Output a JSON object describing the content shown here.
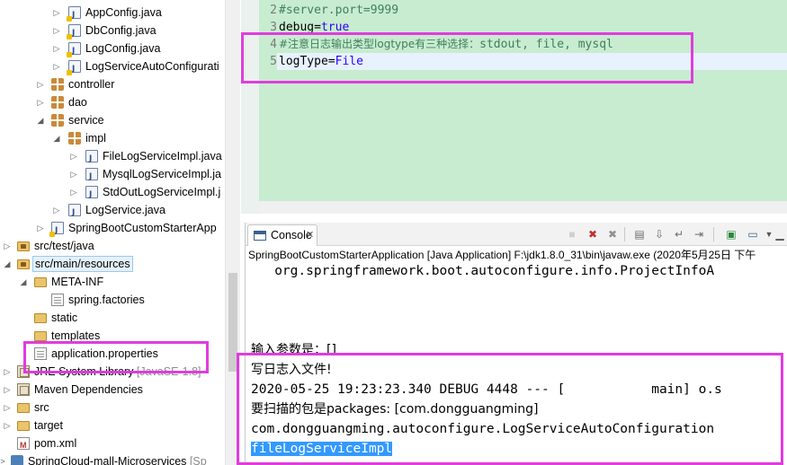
{
  "explorer": {
    "items": [
      {
        "label": "AppConfig.java",
        "icon": "java-file-icon",
        "twisty": "collapsed",
        "warn": true
      },
      {
        "label": "DbConfig.java",
        "icon": "java-file-icon",
        "twisty": "collapsed",
        "warn": true
      },
      {
        "label": "LogConfig.java",
        "icon": "java-file-icon",
        "twisty": "collapsed",
        "warn": true
      },
      {
        "label": "LogServiceAutoConfigurati",
        "icon": "java-file-icon",
        "twisty": "collapsed",
        "warn": true
      },
      {
        "label": "controller",
        "icon": "package-icon",
        "twisty": "collapsed"
      },
      {
        "label": "dao",
        "icon": "package-icon",
        "twisty": "collapsed"
      },
      {
        "label": "service",
        "icon": "package-icon",
        "twisty": "expanded"
      },
      {
        "label": "impl",
        "icon": "package-icon",
        "twisty": "expanded"
      },
      {
        "label": "FileLogServiceImpl.java",
        "icon": "java-file-icon",
        "twisty": "collapsed"
      },
      {
        "label": "MysqlLogServiceImpl.ja",
        "icon": "java-file-icon",
        "twisty": "collapsed"
      },
      {
        "label": "StdOutLogServiceImpl.j",
        "icon": "java-file-icon",
        "twisty": "collapsed"
      },
      {
        "label": "LogService.java",
        "icon": "java-file-icon",
        "twisty": "collapsed"
      },
      {
        "label": "SpringBootCustomStarterApp",
        "icon": "java-file-icon",
        "twisty": "collapsed",
        "warn": true
      },
      {
        "label": "src/test/java",
        "icon": "source-folder-icon",
        "twisty": "collapsed"
      },
      {
        "label": "src/main/resources",
        "icon": "source-folder-icon",
        "twisty": "expanded",
        "selected": true
      },
      {
        "label": "META-INF",
        "icon": "folder-icon",
        "twisty": "expanded"
      },
      {
        "label": "spring.factories",
        "icon": "file-icon"
      },
      {
        "label": "static",
        "icon": "folder-icon"
      },
      {
        "label": "templates",
        "icon": "folder-icon"
      },
      {
        "label": "application.properties",
        "icon": "properties-file-icon"
      },
      {
        "label": "JRE System Library",
        "deco": " [JavaSE-1.8]",
        "icon": "library-icon",
        "twisty": "collapsed"
      },
      {
        "label": "Maven Dependencies",
        "icon": "library-icon",
        "twisty": "collapsed"
      },
      {
        "label": "src",
        "icon": "folder-icon",
        "twisty": "collapsed"
      },
      {
        "label": "target",
        "icon": "folder-icon",
        "twisty": "collapsed"
      },
      {
        "label": "pom.xml",
        "icon": "maven-xml-icon"
      },
      {
        "label": "SpringCloud-mall-Microservices",
        "deco": " [Sp",
        "icon": "project-icon",
        "twisty": "collapsed"
      }
    ]
  },
  "editor": {
    "lines": [
      {
        "no": "2",
        "comment": "#server.port=9999"
      },
      {
        "no": "3",
        "key": "debug=",
        "value": "true"
      },
      {
        "no": "4",
        "comment_cn": "#注意日志输出类型logtype有三种选择：",
        "comment": "stdout, file, mysql"
      },
      {
        "no": "5",
        "key": "logType=",
        "value": "File",
        "current": true
      }
    ]
  },
  "console": {
    "tab_label": "Console",
    "tab_close": "✕",
    "description": "SpringBootCustomStarterApplication [Java Application] F:\\jdk1.8.0_31\\bin\\javaw.exe (2020年5月25日 下午",
    "lines": [
      {
        "text": "   org.springframework.boot.autoconfigure.info.ProjectInfoA"
      },
      {
        "text": "输入参数是：[]",
        "cjk": true
      },
      {
        "text": "写日志入文件!",
        "cjk": true
      },
      {
        "text": "2020-05-25 19:23:23.340 DEBUG 4448 --- [           main] o.s"
      },
      {
        "text": "要扫描的包是packages: [com.dongguangming]",
        "cjk": true
      },
      {
        "text": "com.dongguangming.autoconfigure.LogServiceAutoConfiguration"
      },
      {
        "text": "fileLogServiceImpl",
        "selected": true
      }
    ],
    "toolbar": [
      "terminate-icon",
      "remove-launch-icon",
      "remove-all-icon",
      "clear-console-icon",
      "scroll-lock-icon",
      "word-wrap-icon",
      "pin-console-icon",
      "display-console-icon",
      "open-console-icon",
      "minimize-icon",
      "maximize-icon"
    ]
  },
  "colors": {
    "highlight_box": "#e03cde",
    "editor_bg": "#c8ecd0",
    "selection": "#3399ff"
  }
}
